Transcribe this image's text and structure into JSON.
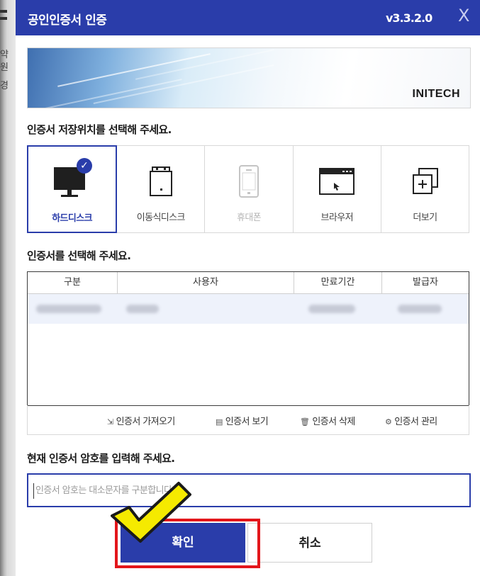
{
  "background_page": {
    "side_chars": [
      "약",
      "원",
      "경"
    ]
  },
  "dialog": {
    "title": "공인인증서 인증",
    "version": "v3.3.2.0",
    "close_label": "X",
    "banner_logo": "INITECH",
    "accent_color": "#2a3daa",
    "storage": {
      "prompt": "인증서 저장위치를 선택해 주세요.",
      "options": [
        {
          "label": "하드디스크",
          "icon": "monitor-icon",
          "selected": true,
          "disabled": false
        },
        {
          "label": "이동식디스크",
          "icon": "usb-drive-icon",
          "selected": false,
          "disabled": false
        },
        {
          "label": "휴대폰",
          "icon": "phone-icon",
          "selected": false,
          "disabled": true
        },
        {
          "label": "브라우저",
          "icon": "browser-icon",
          "selected": false,
          "disabled": false
        },
        {
          "label": "더보기",
          "icon": "more-icon",
          "selected": false,
          "disabled": false
        }
      ]
    },
    "certificates": {
      "prompt": "인증서를 선택해 주세요.",
      "columns": [
        "구분",
        "사용자",
        "만료기간",
        "발급자"
      ]
    },
    "tools": [
      {
        "label": "인증서 가져오기",
        "icon": "import-icon",
        "glyph": "⇲"
      },
      {
        "label": "인증서 보기",
        "icon": "view-icon",
        "glyph": "▤"
      },
      {
        "label": "인증서 삭제",
        "icon": "trash-icon",
        "glyph": "🗑"
      },
      {
        "label": "인증서 관리",
        "icon": "gear-icon",
        "glyph": "⚙"
      }
    ],
    "password": {
      "prompt": "현재 인증서 암호를 입력해 주세요.",
      "placeholder": "인증서 암호는 대소문자를 구분합니다.",
      "value": ""
    },
    "buttons": {
      "ok": "확인",
      "cancel": "취소"
    },
    "annotation_color": "#e3161b"
  }
}
